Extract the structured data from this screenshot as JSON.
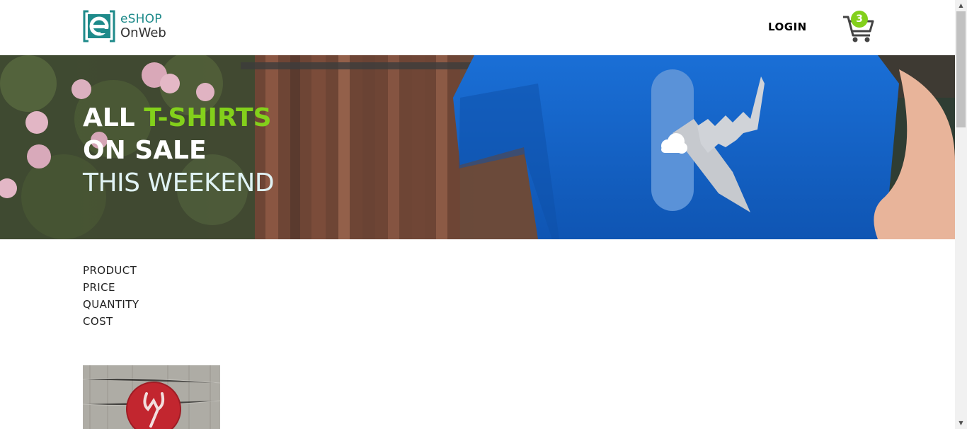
{
  "header": {
    "logo_text_1": "eSHOP",
    "logo_text_2": "OnWeb",
    "login_label": "LOGIN",
    "cart_count": "3"
  },
  "hero": {
    "line1_a": "ALL",
    "line1_b": "T-SHIRTS",
    "line2": "ON SALE",
    "line3": "THIS WEEKEND"
  },
  "cart_table": {
    "labels": [
      "PRODUCT",
      "PRICE",
      "QUANTITY",
      "COST"
    ]
  },
  "colors": {
    "accent": "#83d01b",
    "logo": "#1e8a8a",
    "shirt": "#1565c9"
  }
}
